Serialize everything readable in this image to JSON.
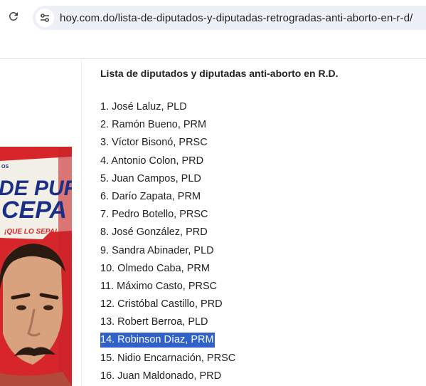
{
  "browser": {
    "url": "hoy.com.do/lista-de-diputados-y-diputadas-retrogradas-anti-aborto-en-r-d/",
    "reload_icon": "reload-icon",
    "site_info_icon": "tune-icon"
  },
  "article": {
    "heading": "Lista de diputados y diputadas anti-aborto en R.D.",
    "items": [
      "1. José Laluz, PLD",
      "2. Ramón Bueno, PRM",
      "3. Víctor Bisonó, PRSC",
      "4. Antonio Colon, PRD",
      "5. Juan Campos, PLD",
      "6. Darío Zapata, PRM",
      "7. Pedro Botello, PRSC",
      "8. José González, PRD",
      "9. Sandra Abinader, PLD",
      "10. Olmedo Caba, PRM",
      "11. Máximo Casto, PRSC",
      "12. Cristóbal Castillo, PRD",
      "13. Robert Berroa, PLD",
      "14. Robinson Díaz, PRM",
      "15. Nidio Encarnación, PRSC",
      "16. Juan Maldonado, PRD"
    ],
    "selected_index": 13
  },
  "poster": {
    "title_line1": "DE PURA",
    "title_line2": "CEPA",
    "tagline": "¡QUE LO SEPA!",
    "top_text": "OS",
    "colors": {
      "background": "#d7262b",
      "light": "#f2efe6",
      "title": "#1c2f86"
    }
  }
}
